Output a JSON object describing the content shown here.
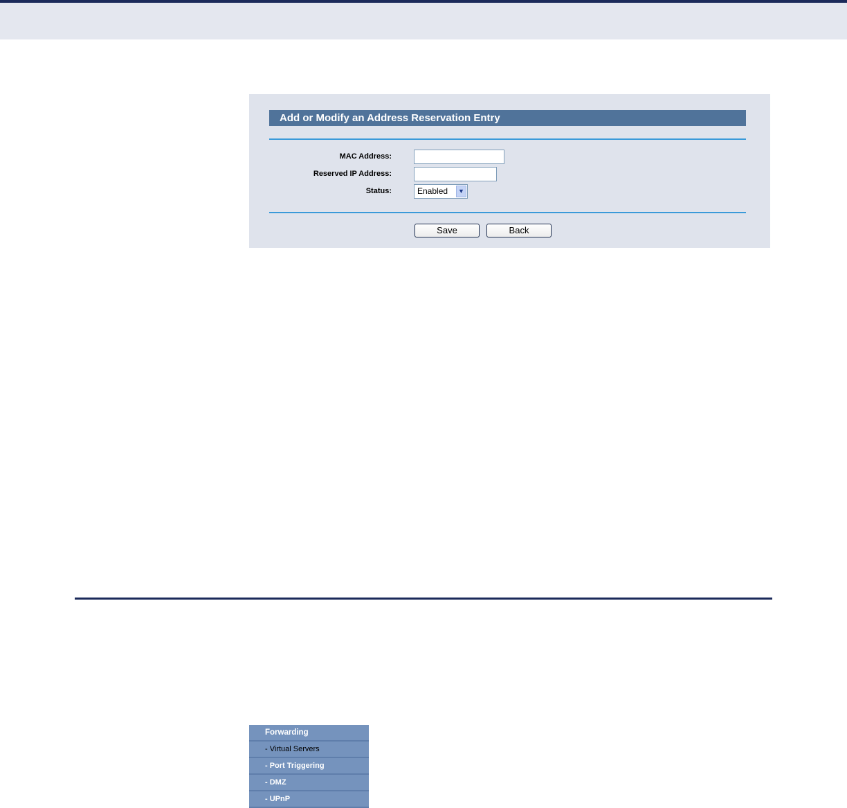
{
  "form": {
    "title": "Add or Modify an Address Reservation Entry",
    "mac_label": "MAC Address:",
    "mac_value": "",
    "ip_label": "Reserved IP Address:",
    "ip_value": "",
    "status_label": "Status:",
    "status_value": "Enabled",
    "save_label": "Save",
    "back_label": "Back"
  },
  "menu": {
    "header": "Forwarding",
    "items": [
      "- Virtual Servers",
      "- Port Triggering",
      "- DMZ",
      "- UPnP"
    ],
    "active_index": 0
  },
  "colors": {
    "panel_bg": "#dfe3ec",
    "title_bar": "#50739a",
    "rule": "#3a9ad9",
    "menu_bg": "#7593bd"
  }
}
